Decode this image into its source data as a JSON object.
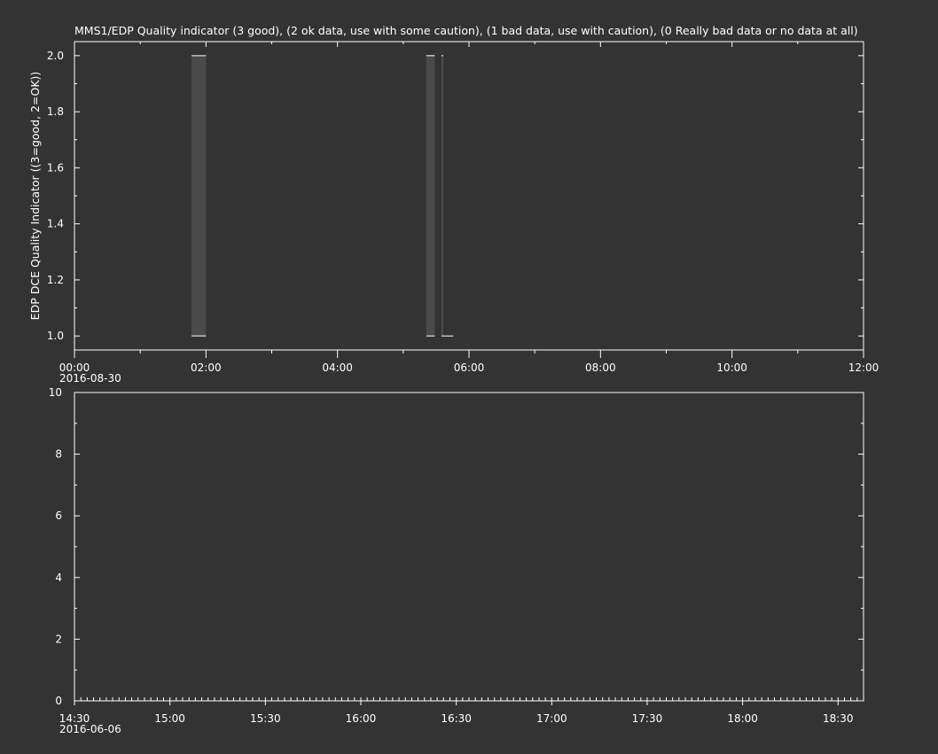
{
  "colors": {
    "background": "#333333",
    "foreground": "#ffffff",
    "fill": "#4a4a4a"
  },
  "chart_data": [
    {
      "type": "line",
      "title": "MMS1/EDP  Quality indicator (3 good), (2 ok data, use with some caution), (1 bad data, use with caution), (0 Really bad data or no data at all)",
      "ylabel": "EDP DCE Quality Indicator ((3=good, 2=OK))",
      "xlabel": "",
      "ylim": [
        0.95,
        2.05
      ],
      "yticks": [
        1.0,
        1.2,
        1.4,
        1.6,
        1.8,
        2.0
      ],
      "ytick_labels": [
        "1.0",
        "1.2",
        "1.4",
        "1.6",
        "1.8",
        "2.0"
      ],
      "xlim_hours": [
        0,
        12
      ],
      "xticks_hours": [
        0,
        2,
        4,
        6,
        8,
        10,
        12
      ],
      "xtick_labels": [
        "00:00",
        "02:00",
        "04:00",
        "06:00",
        "08:00",
        "10:00",
        "12:00"
      ],
      "date_label": "2016-08-30",
      "series": [
        {
          "segments": [
            {
              "x_start_hours": 1.78,
              "x_end_hours": 2.0,
              "y_high": 2.0,
              "y_low": 1.0
            },
            {
              "x_start_hours": 5.35,
              "x_end_hours": 5.48,
              "y_high": 2.0,
              "y_low": 1.0
            },
            {
              "x_start_hours": 5.58,
              "x_end_hours": 5.61,
              "y_high": 2.0,
              "y_low": 1.0
            }
          ],
          "low_tails": [
            {
              "x_start_hours": 5.61,
              "x_end_hours": 5.76,
              "y": 1.0
            }
          ]
        }
      ]
    },
    {
      "type": "line",
      "title": "",
      "ylabel": "",
      "xlabel": "",
      "ylim": [
        0,
        10
      ],
      "yticks": [
        0,
        2,
        4,
        6,
        8,
        10
      ],
      "ytick_labels": [
        "0",
        "2",
        "4",
        "6",
        "8",
        "10"
      ],
      "xlim_minutes": [
        870,
        1118
      ],
      "xticks_minutes": [
        870,
        900,
        930,
        960,
        990,
        1020,
        1050,
        1080,
        1110
      ],
      "xtick_labels": [
        "14:30",
        "15:00",
        "15:30",
        "16:00",
        "16:30",
        "17:00",
        "17:30",
        "18:00",
        "18:30"
      ],
      "date_label": "2016-06-06",
      "series": []
    }
  ]
}
